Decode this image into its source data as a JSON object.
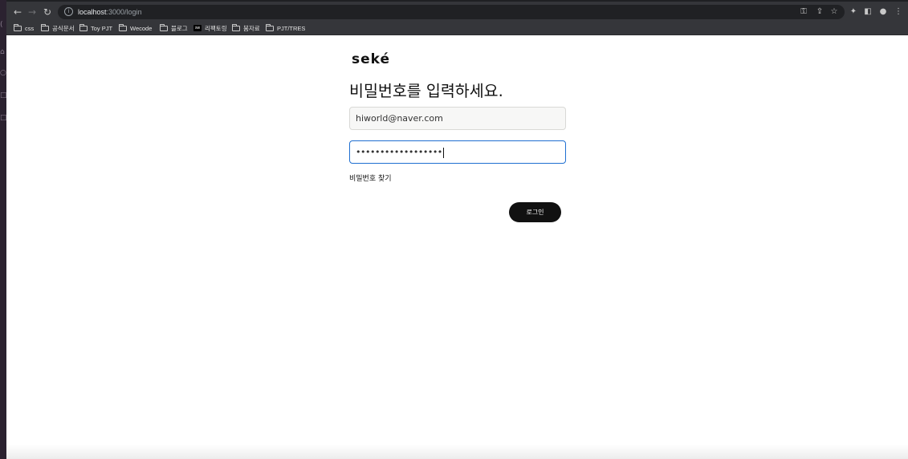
{
  "browser": {
    "url_host": "localhost",
    "url_path": ":3000/login",
    "bookmarks": [
      {
        "label": "css",
        "icon": "folder-icon"
      },
      {
        "label": "공식문서",
        "icon": "folder-icon"
      },
      {
        "label": "Toy PJT",
        "icon": "folder-icon"
      },
      {
        "label": "Wecode",
        "icon": "folder-icon"
      },
      {
        "label": "블로그",
        "icon": "folder-icon"
      },
      {
        "label": "리팩토링",
        "icon": "site-favicon"
      },
      {
        "label": "붐자료",
        "icon": "folder-icon"
      },
      {
        "label": "PJT/TRES",
        "icon": "folder-icon"
      }
    ],
    "favicon_text": "sw"
  },
  "login": {
    "logo": "seké",
    "heading": "비밀번호를 입력하세요.",
    "email_value": "hiworld@naver.com",
    "password_masked": "••••••••••••••••••",
    "find_password_label": "비밀번호 찾기",
    "login_button_label": "로그인"
  },
  "colors": {
    "focus_border": "#1f6fd1",
    "button_bg": "#111111",
    "toolbar_bg": "#35363a"
  }
}
